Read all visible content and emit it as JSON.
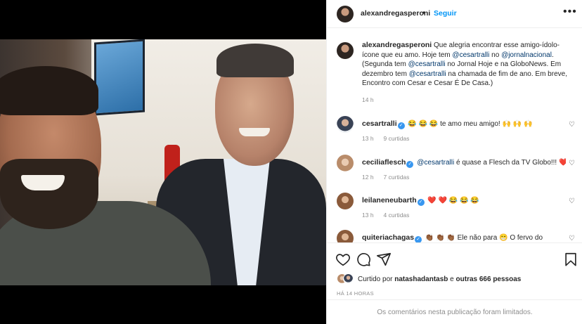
{
  "header": {
    "username": "alexandregasperoni",
    "dot": "•",
    "follow_label": "Seguir",
    "more_icon": "more-horizontal-icon"
  },
  "caption": {
    "username": "alexandregasperoni",
    "part1": " Que alegria encontrar esse amigo-ídolo-ícone que eu amo. Hoje tem ",
    "mention1": "@cesartralli",
    "part2": " no ",
    "mention2": "@jornalnacional",
    "part3": ". (Segunda tem ",
    "mention3": "@cesartralli",
    "part4": " no Jornal Hoje e na GloboNews. Em dezembro tem ",
    "mention4": "@cesartralli",
    "part5": " na chamada de fim de ano. Em breve, Encontro com Cesar e Cesar É De Casa.)",
    "time": "14 h"
  },
  "comments": [
    {
      "username": "cesartralli",
      "verified": true,
      "text_emoji": "😂 😂 😂",
      "text": " te amo meu amigo! ",
      "text_emoji2": "🙌 🙌 🙌",
      "time": "13 h",
      "likes": "9 curtidas"
    },
    {
      "username": "ceciliaflesch",
      "verified": true,
      "mention": "@cesartralli",
      "text": " é quase a Flesch da TV Globo!!! ",
      "text_emoji": "❤️",
      "time": "12 h",
      "likes": "7 curtidas"
    },
    {
      "username": "leilaneneubarth",
      "verified": true,
      "text_emoji": "❤️ ❤️",
      "text_emoji2": "😂 😂 😂",
      "time": "13 h",
      "likes": "4 curtidas"
    },
    {
      "username": "quiteriachagas",
      "verified": true,
      "text_emoji": "👏🏾 👏🏾 👏🏾",
      "text": " Ele não para ",
      "text_emoji2": "😁",
      "text2": " O fervo do"
    }
  ],
  "actions": {
    "like_icon": "heart-icon",
    "comment_icon": "comment-icon",
    "share_icon": "send-icon",
    "save_icon": "bookmark-icon"
  },
  "likes": {
    "prefix": "Curtido por ",
    "user": "natashadantasb",
    "middle": " e ",
    "others": "outras 666 pessoas"
  },
  "post_time": "HÁ 14 HORAS",
  "comments_limited": "Os comentários nesta publicação foram limitados."
}
